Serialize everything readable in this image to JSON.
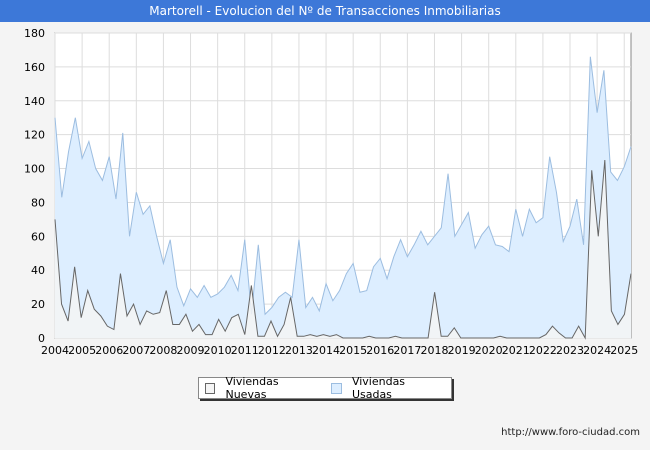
{
  "title": "Martorell - Evolucion del Nº de Transacciones Inmobiliarias",
  "footer_url": "http://www.foro-ciudad.com",
  "chart_data": {
    "type": "area",
    "title": "Martorell - Evolucion del Nº de Transacciones Inmobiliarias",
    "xlabel": "",
    "ylabel": "",
    "ylim": [
      0,
      180
    ],
    "yticks": [
      0,
      20,
      40,
      60,
      80,
      100,
      120,
      140,
      160,
      180
    ],
    "x_tick_labels": [
      "2004",
      "2005",
      "2006",
      "2007",
      "2008",
      "2009",
      "2010",
      "2011",
      "2012",
      "2013",
      "2014",
      "2015",
      "2016",
      "2017",
      "2018",
      "2019",
      "2020",
      "2021",
      "2022",
      "2023",
      "2024",
      "2025"
    ],
    "x_start": 2004,
    "x_end": 2025.25,
    "grid": true,
    "legend_position": "bottom",
    "series": [
      {
        "name": "Viviendas Nuevas",
        "color": "#666666",
        "fill": "#f5f5f5",
        "values": [
          70,
          20,
          10,
          42,
          12,
          28,
          17,
          13,
          7,
          5,
          38,
          13,
          20,
          8,
          16,
          14,
          15,
          28,
          8,
          8,
          14,
          4,
          8,
          2,
          2,
          11,
          4,
          12,
          14,
          2,
          31,
          1,
          1,
          10,
          1,
          8,
          24,
          1,
          1,
          2,
          1,
          2,
          1,
          2,
          0,
          0,
          0,
          0,
          1,
          0,
          0,
          0,
          1,
          0,
          0,
          0,
          0,
          0,
          27,
          1,
          1,
          6,
          0,
          0,
          0,
          0,
          0,
          0,
          1,
          0,
          0,
          0,
          0,
          0,
          0,
          2,
          7,
          3,
          0,
          0,
          7,
          0,
          99,
          60,
          105,
          16,
          8,
          14,
          38
        ]
      },
      {
        "name": "Viviendas Usadas",
        "color": "#9cbde0",
        "fill": "#ddeeff",
        "values": [
          130,
          83,
          110,
          130,
          106,
          116,
          100,
          93,
          107,
          82,
          121,
          60,
          86,
          73,
          78,
          60,
          44,
          58,
          30,
          19,
          29,
          24,
          31,
          24,
          26,
          30,
          37,
          28,
          58,
          14,
          55,
          14,
          18,
          24,
          27,
          24,
          58,
          18,
          24,
          16,
          32,
          22,
          28,
          38,
          44,
          27,
          28,
          42,
          47,
          35,
          48,
          58,
          48,
          55,
          63,
          55,
          60,
          65,
          97,
          60,
          67,
          74,
          53,
          61,
          66,
          55,
          54,
          51,
          76,
          60,
          76,
          68,
          71,
          107,
          86,
          57,
          66,
          82,
          55,
          166,
          133,
          158,
          98,
          93,
          101,
          113
        ]
      }
    ]
  }
}
